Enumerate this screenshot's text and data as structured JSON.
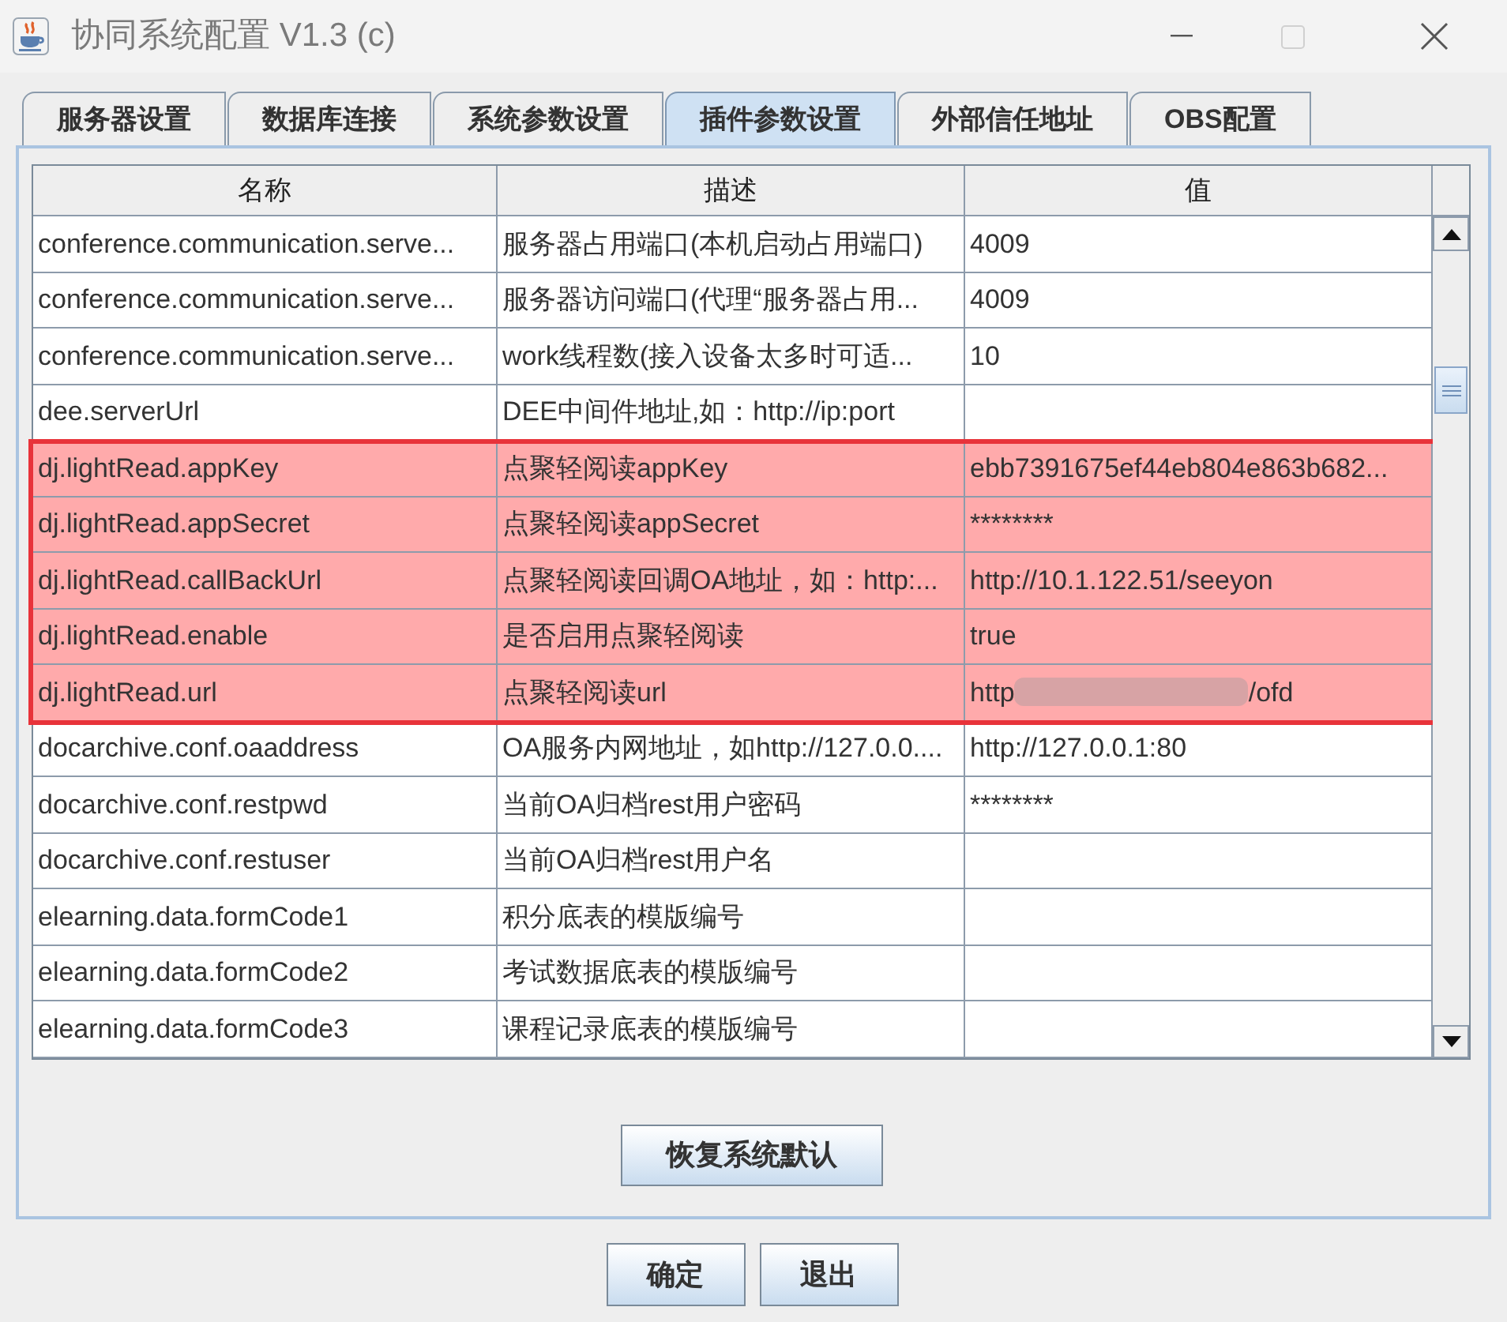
{
  "window": {
    "title": "协同系统配置 V1.3 (c)",
    "maximize_enabled": false
  },
  "tabs": [
    {
      "label": "服务器设置",
      "selected": false
    },
    {
      "label": "数据库连接",
      "selected": false
    },
    {
      "label": "系统参数设置",
      "selected": false
    },
    {
      "label": "插件参数设置",
      "selected": true
    },
    {
      "label": "外部信任地址",
      "selected": false
    },
    {
      "label": "OBS配置",
      "selected": false
    }
  ],
  "table": {
    "columns": [
      "名称",
      "描述",
      "值"
    ],
    "rows": [
      {
        "name": "conference.communication.serve...",
        "description": "服务器占用端口(本机启动占用端口)",
        "value": "4009",
        "highlighted": false,
        "redacted": false
      },
      {
        "name": "conference.communication.serve...",
        "description": "服务器访问端口(代理“服务器占用...",
        "value": "4009",
        "highlighted": false,
        "redacted": false
      },
      {
        "name": "conference.communication.serve...",
        "description": "work线程数(接入设备太多时可适...",
        "value": "10",
        "highlighted": false,
        "redacted": false
      },
      {
        "name": "dee.serverUrl",
        "description": "DEE中间件地址,如：http://ip:port",
        "highlighted": false,
        "redacted": false
      },
      {
        "name": "dj.lightRead.appKey",
        "description": "点聚轻阅读appKey",
        "value": "ebb7391675ef44eb804e863b682...",
        "highlighted": true,
        "redacted": false
      },
      {
        "name": "dj.lightRead.appSecret",
        "description": "点聚轻阅读appSecret",
        "value": "********",
        "highlighted": true,
        "redacted": false
      },
      {
        "name": "dj.lightRead.callBackUrl",
        "description": "点聚轻阅读回调OA地址，如：http:...",
        "value": "http://10.1.122.51/seeyon",
        "highlighted": true,
        "redacted": false
      },
      {
        "name": "dj.lightRead.enable",
        "description": "是否启用点聚轻阅读",
        "value": "true",
        "highlighted": true,
        "redacted": false
      },
      {
        "name": "dj.lightRead.url",
        "description": "点聚轻阅读url",
        "value": "http",
        "value_end": "/ofd",
        "highlighted": true,
        "redacted": true
      },
      {
        "name": "docarchive.conf.oaaddress",
        "description": "OA服务内网地址，如http://127.0.0....",
        "value": "http://127.0.0.1:80",
        "highlighted": false,
        "redacted": false
      },
      {
        "name": "docarchive.conf.restpwd",
        "description": "当前OA归档rest用户密码",
        "value": "********",
        "highlighted": false,
        "redacted": false
      },
      {
        "name": "docarchive.conf.restuser",
        "description": "当前OA归档rest用户名",
        "highlighted": false,
        "redacted": false
      },
      {
        "name": "elearning.data.formCode1",
        "description": "积分底表的模版编号",
        "highlighted": false,
        "redacted": false
      },
      {
        "name": "elearning.data.formCode2",
        "description": "考试数据底表的模版编号",
        "highlighted": false,
        "redacted": false
      },
      {
        "name": "elearning.data.formCode3",
        "description": "课程记录底表的模版编号",
        "highlighted": false,
        "redacted": false
      }
    ]
  },
  "restore_button": "恢复系统默认",
  "footer_buttons": [
    "确定",
    "退出"
  ]
}
